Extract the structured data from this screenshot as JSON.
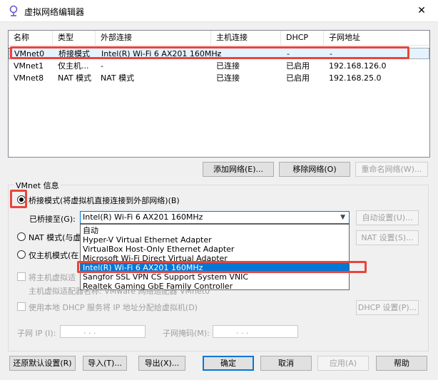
{
  "window": {
    "title": "虚拟网络编辑器",
    "close_glyph": "✕"
  },
  "network_table": {
    "columns": [
      "名称",
      "类型",
      "外部连接",
      "主机连接",
      "DHCP",
      "子网地址"
    ],
    "rows": [
      [
        "VMnet0",
        "桥接模式",
        "Intel(R) Wi-Fi 6 AX201 160MHz",
        "-",
        "-",
        "-"
      ],
      [
        "VMnet1",
        "仅主机...",
        "-",
        "已连接",
        "已启用",
        "192.168.126.0"
      ],
      [
        "VMnet8",
        "NAT 模式",
        "NAT 模式",
        "已连接",
        "已启用",
        "192.168.25.0"
      ]
    ]
  },
  "table_buttons": {
    "add": "添加网络(E)...",
    "remove": "移除网络(O)",
    "rename": "重命名网络(W)..."
  },
  "vmnet_info": {
    "label": "VMnet 信息",
    "bridged_label": "桥接模式(将虚拟机直接连接到外部网络)(B)",
    "bridged_to_label": "已桥接至(G):",
    "bridged_to_value": "Intel(R) Wi-Fi 6 AX201 160MHz",
    "auto_settings": "自动设置(U)...",
    "nat_label": "NAT 模式(与虚",
    "nat_settings": "NAT 设置(S)...",
    "hostonly_label": "仅主机模式(在",
    "host_adapter_label": "将主机虚拟适",
    "host_adapter_sub": "主机虚拟适配器名称: VMware 网络适配器 VMnet0",
    "dhcp_label": "使用本地 DHCP 服务将 IP 地址分配给虚拟机(D)",
    "dhcp_settings": "DHCP 设置(P)...",
    "subnet_ip_label": "子网 IP (I):",
    "subnet_mask_label": "子网掩码(M):",
    "ip_dots": ".   .   ."
  },
  "dropdown_options": [
    "自动",
    "Hyper-V Virtual Ethernet Adapter",
    "VirtualBox Host-Only Ethernet Adapter",
    "Microsoft Wi-Fi Direct Virtual Adapter",
    "Intel(R) Wi-Fi 6 AX201 160MHz",
    "Sangfor SSL VPN CS Support System VNIC",
    "Realtek Gaming GbE Family Controller"
  ],
  "footer_buttons": {
    "restore": "还原默认设置(R)",
    "import": "导入(T)...",
    "export": "导出(X)...",
    "ok": "确定",
    "cancel": "取消",
    "apply": "应用(A)",
    "help": "帮助"
  },
  "colors": {
    "highlight": "#e8453c",
    "selection": "#0078d7"
  }
}
